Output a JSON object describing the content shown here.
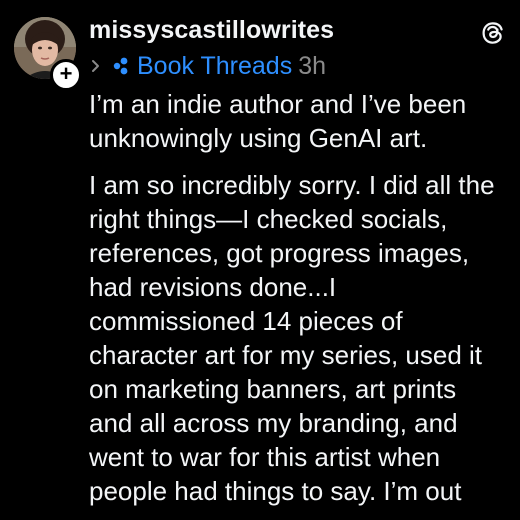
{
  "post": {
    "username": "missyscastillowrites",
    "community": "Book Threads",
    "timestamp": "3h",
    "paragraphs": [
      "I’m an indie author and I’ve been\nunknowingly using GenAI art.",
      "I am so incredibly sorry. I did all the\nright things—I checked socials,\nreferences, got progress images,\nhad revisions done...I\ncommissioned 14 pieces of\ncharacter art for my series, used it\non marketing banners, art prints\nand all across my branding, and\nwent to war for this artist when\npeople had things to say. I’m out"
    ]
  },
  "icons": {
    "threads_logo": "threads-logo-icon",
    "chevron": "chevron-right-icon",
    "community": "community-dots-icon",
    "follow": "plus-icon"
  },
  "colors": {
    "background": "#000000",
    "text": "#f3f5f7",
    "community_link": "#2e8fff",
    "timestamp": "#8a8a8a"
  }
}
